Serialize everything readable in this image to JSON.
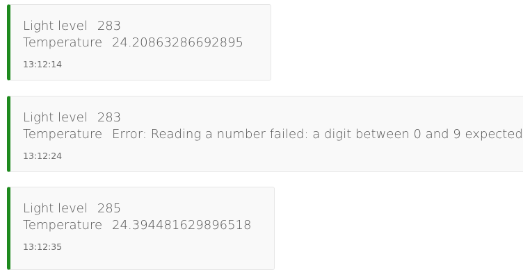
{
  "readings": [
    {
      "light_label": "Light level",
      "light_value": "283",
      "temp_label": "Temperature",
      "temp_value": "24.20863286692895",
      "time": "13:12:14"
    },
    {
      "light_label": "Light level",
      "light_value": "283",
      "temp_label": "Temperature",
      "temp_value": "Error: Reading a number failed: a digit between 0 and 9 expected",
      "time": "13:12:24"
    },
    {
      "light_label": "Light level",
      "light_value": "285",
      "temp_label": "Temperature",
      "temp_value": "24.394481629896518",
      "time": "13:12:35"
    }
  ],
  "colors": {
    "accent": "#1e8a1e",
    "card_bg": "#f9f9f9",
    "card_border": "#e6e6e6"
  }
}
